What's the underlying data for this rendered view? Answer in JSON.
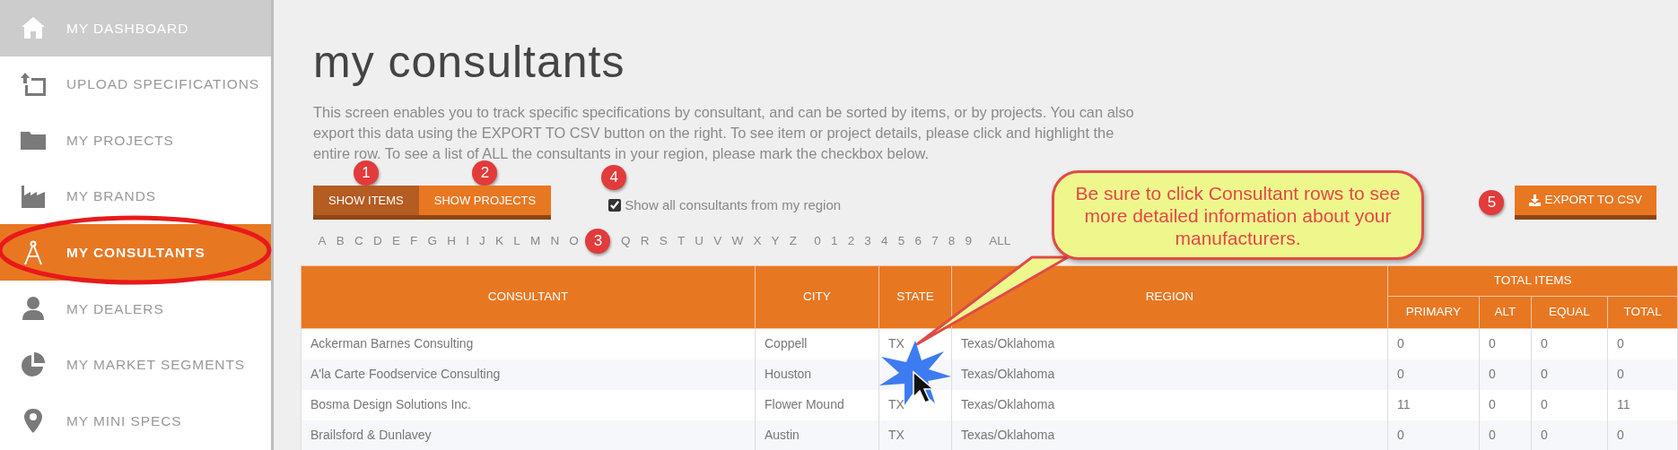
{
  "sidebar": {
    "items": [
      {
        "label": "MY DASHBOARD",
        "selected": false,
        "highlighted": true
      },
      {
        "label": "UPLOAD SPECIFICATIONS",
        "selected": false,
        "highlighted": false
      },
      {
        "label": "MY PROJECTS",
        "selected": false,
        "highlighted": false
      },
      {
        "label": "MY BRANDS",
        "selected": false,
        "highlighted": false
      },
      {
        "label": "MY CONSULTANTS",
        "selected": true,
        "highlighted": false
      },
      {
        "label": "MY DEALERS",
        "selected": false,
        "highlighted": false
      },
      {
        "label": "MY MARKET SEGMENTS",
        "selected": false,
        "highlighted": false
      },
      {
        "label": "MY MINI SPECS",
        "selected": false,
        "highlighted": false
      }
    ]
  },
  "page": {
    "title": "my consultants",
    "description": "This screen enables you to track specific specifications by consultant, and can be sorted by items, or by projects. You can also export this data using the EXPORT TO CSV button on the right. To see item or project details, please click and highlight the entire row. To see a list of ALL the consultants in your region, please mark the checkbox below.",
    "tabs": [
      {
        "label": "SHOW ITEMS",
        "selected": true,
        "badge": "1"
      },
      {
        "label": "SHOW PROJECTS",
        "selected": false,
        "badge": "2"
      }
    ],
    "checkbox": {
      "label": "Show all consultants from my region",
      "checked": true,
      "badge": "4"
    },
    "export_button": {
      "label": "EXPORT TO CSV",
      "badge": "5"
    },
    "letters": {
      "before_badge": [
        "A",
        "B",
        "C",
        "D",
        "E",
        "F",
        "G",
        "H",
        "I",
        "J",
        "K",
        "L",
        "M",
        "N",
        "O"
      ],
      "badge": "3",
      "after_badge": [
        "Q",
        "R",
        "S",
        "T",
        "U",
        "V",
        "W",
        "X",
        "Y",
        "Z",
        "0",
        "1",
        "2",
        "3",
        "4",
        "5",
        "6",
        "7",
        "8",
        "9",
        "ALL"
      ]
    },
    "callout": "Be sure to click Consultant rows to see more detailed information about your manufacturers."
  },
  "table": {
    "columns": [
      "CONSULTANT",
      "CITY",
      "STATE",
      "REGION"
    ],
    "group": {
      "label": "TOTAL ITEMS",
      "columns": [
        "PRIMARY",
        "ALT",
        "EQUAL",
        "TOTAL"
      ]
    },
    "rows": [
      [
        "Ackerman Barnes Consulting",
        "Coppell",
        "TX",
        "Texas/Oklahoma",
        "0",
        "0",
        "0",
        "0"
      ],
      [
        "A'la Carte Foodservice Consulting",
        "Houston",
        "",
        "Texas/Oklahoma",
        "0",
        "0",
        "0",
        "0"
      ],
      [
        "Bosma Design Solutions Inc.",
        "Flower Mound",
        "TX",
        "Texas/Oklahoma",
        "11",
        "0",
        "0",
        "11"
      ],
      [
        "Brailsford & Dunlavey",
        "Austin",
        "TX",
        "Texas/Oklahoma",
        "0",
        "0",
        "0",
        "0"
      ]
    ]
  }
}
